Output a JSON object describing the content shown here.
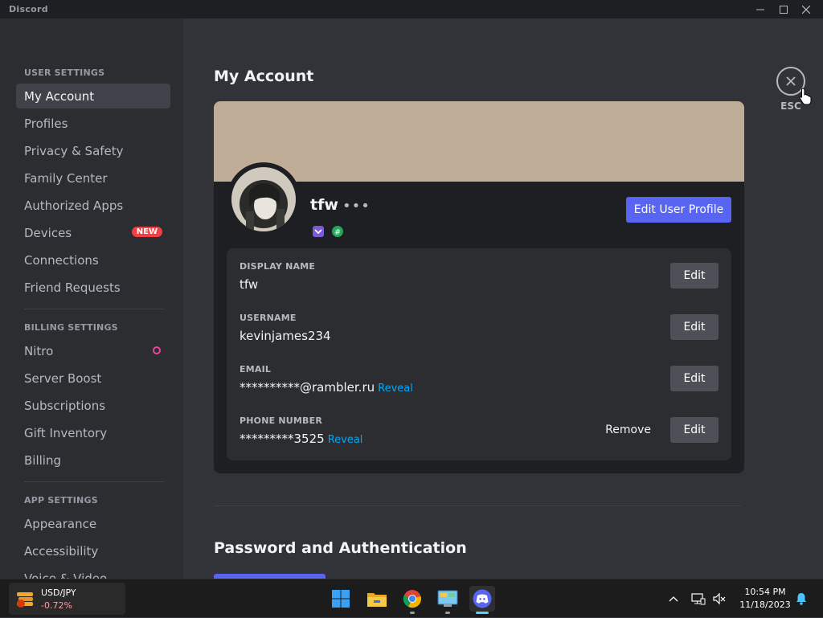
{
  "window": {
    "title": "Discord"
  },
  "sidebar": {
    "sections": [
      {
        "header": "USER SETTINGS",
        "items": [
          "My Account",
          "Profiles",
          "Privacy & Safety",
          "Family Center",
          "Authorized Apps",
          "Devices",
          "Connections",
          "Friend Requests"
        ]
      },
      {
        "header": "BILLING SETTINGS",
        "items": [
          "Nitro",
          "Server Boost",
          "Subscriptions",
          "Gift Inventory",
          "Billing"
        ]
      },
      {
        "header": "APP SETTINGS",
        "items": [
          "Appearance",
          "Accessibility",
          "Voice & Video"
        ]
      }
    ],
    "active_item": "My Account",
    "devices_badge": "NEW"
  },
  "main": {
    "title": "My Account",
    "close_label": "ESC",
    "profile": {
      "username": "tfw",
      "banner_color": "#bfad98",
      "edit_profile_label": "Edit User Profile"
    },
    "fields": [
      {
        "label": "DISPLAY NAME",
        "value": "tfw",
        "reveal": "",
        "edit": "Edit",
        "remove": ""
      },
      {
        "label": "USERNAME",
        "value": "kevinjames234",
        "reveal": "",
        "edit": "Edit",
        "remove": ""
      },
      {
        "label": "EMAIL",
        "value": "**********@rambler.ru",
        "reveal": "Reveal",
        "edit": "Edit",
        "remove": ""
      },
      {
        "label": "PHONE NUMBER",
        "value": "*********3525",
        "reveal": "Reveal",
        "edit": "Edit",
        "remove": "Remove"
      }
    ],
    "section2_title": "Password and Authentication"
  },
  "taskbar": {
    "ticker": {
      "symbol": "USD/JPY",
      "change": "-0.72%"
    },
    "apps": [
      "start-icon",
      "file-explorer-icon",
      "chrome-icon",
      "control-panel-icon",
      "discord-icon"
    ],
    "clock": {
      "time": "10:54 PM",
      "date": "11/18/2023"
    }
  },
  "colors": {
    "accent": "#5865f2",
    "link": "#00a8fc",
    "danger": "#f23f43",
    "nitro": "#eb459e"
  }
}
